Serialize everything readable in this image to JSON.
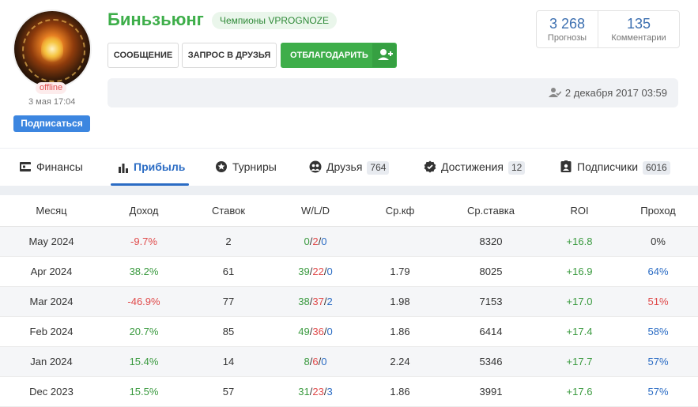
{
  "profile": {
    "name": "Биньзьюнг",
    "badge": "Чемпионы VPROGNOZE",
    "status": "offline",
    "last_seen": "3 мая 17:04",
    "subscribe_label": "Подписаться",
    "buttons": {
      "message": "СООБЩЕНИЕ",
      "friend_request": "ЗАПРОС В ДРУЗЬЯ",
      "thank": "ОТБЛАГОДАРИТЬ"
    },
    "stats": [
      {
        "value": "3 268",
        "label": "Прогнозы"
      },
      {
        "value": "135",
        "label": "Комментарии"
      }
    ],
    "registered": "2 декабря 2017 03:59"
  },
  "tabs": [
    {
      "label": "Финансы",
      "icon": "wallet-icon",
      "count": ""
    },
    {
      "label": "Прибыль",
      "icon": "bar-chart-icon",
      "count": "",
      "active": true
    },
    {
      "label": "Турниры",
      "icon": "star-icon",
      "count": ""
    },
    {
      "label": "Друзья",
      "icon": "friends-icon",
      "count": "764"
    },
    {
      "label": "Достижения",
      "icon": "verified-icon",
      "count": "12"
    },
    {
      "label": "Подписчики",
      "icon": "id-badge-icon",
      "count": "6016"
    }
  ],
  "table": {
    "headers": [
      "Месяц",
      "Доход",
      "Ставок",
      "W/L/D",
      "Ср.кф",
      "Ср.ставка",
      "ROI",
      "Проход"
    ],
    "rows": [
      {
        "month": "May 2024",
        "income": "-9.7%",
        "bets": "2",
        "w": "0",
        "l": "2",
        "d": "0",
        "avg_odds": "",
        "avg_stake": "8320",
        "roi": "+16.8",
        "pass": "0%"
      },
      {
        "month": "Apr 2024",
        "income": "38.2%",
        "bets": "61",
        "w": "39",
        "l": "22",
        "d": "0",
        "avg_odds": "1.79",
        "avg_stake": "8025",
        "roi": "+16.9",
        "pass": "64%"
      },
      {
        "month": "Mar 2024",
        "income": "-46.9%",
        "bets": "77",
        "w": "38",
        "l": "37",
        "d": "2",
        "avg_odds": "1.98",
        "avg_stake": "7153",
        "roi": "+17.0",
        "pass": "51%"
      },
      {
        "month": "Feb 2024",
        "income": "20.7%",
        "bets": "85",
        "w": "49",
        "l": "36",
        "d": "0",
        "avg_odds": "1.86",
        "avg_stake": "6414",
        "roi": "+17.4",
        "pass": "58%"
      },
      {
        "month": "Jan 2024",
        "income": "15.4%",
        "bets": "14",
        "w": "8",
        "l": "6",
        "d": "0",
        "avg_odds": "2.24",
        "avg_stake": "5346",
        "roi": "+17.7",
        "pass": "57%"
      },
      {
        "month": "Dec 2023",
        "income": "15.5%",
        "bets": "57",
        "w": "31",
        "l": "23",
        "d": "3",
        "avg_odds": "1.86",
        "avg_stake": "3991",
        "roi": "+17.6",
        "pass": "57%"
      }
    ]
  },
  "colors": {
    "green": "#3eae4a",
    "red": "#e04b4b",
    "blue": "#2b6cc4"
  }
}
